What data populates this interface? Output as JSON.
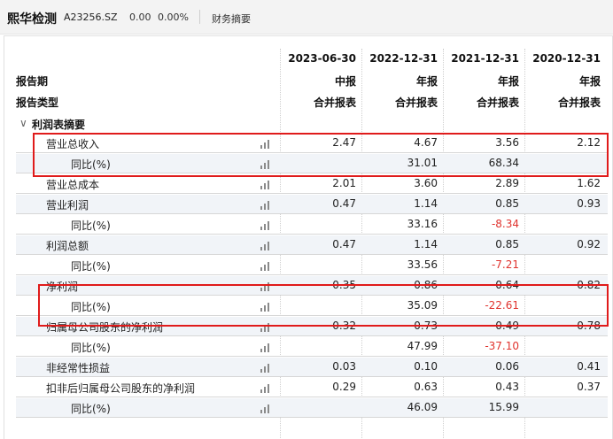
{
  "header": {
    "company": "熙华检测",
    "code": "A23256.SZ",
    "price": "0.00",
    "change_pct": "0.00%",
    "tab": "财务摘要"
  },
  "table": {
    "columns": [
      "2023-06-30",
      "2022-12-31",
      "2021-12-31",
      "2020-12-31"
    ],
    "report_period_label": "报告期",
    "report_type_label": "报告类型",
    "periods": [
      "中报",
      "年报",
      "年报",
      "年报"
    ],
    "report_types": [
      "合并报表",
      "合并报表",
      "合并报表",
      "合并报表"
    ],
    "section_title": "利润表摘要",
    "rows": [
      {
        "label": "营业总收入",
        "values": [
          "2.47",
          "4.67",
          "3.56",
          "2.12"
        ]
      },
      {
        "label": "同比(%)",
        "values": [
          "",
          "31.01",
          "68.34",
          ""
        ]
      },
      {
        "label": "营业总成本",
        "values": [
          "2.01",
          "3.60",
          "2.89",
          "1.62"
        ]
      },
      {
        "label": "营业利润",
        "values": [
          "0.47",
          "1.14",
          "0.85",
          "0.93"
        ]
      },
      {
        "label": "同比(%)",
        "values": [
          "",
          "33.16",
          "-8.34",
          ""
        ]
      },
      {
        "label": "利润总额",
        "values": [
          "0.47",
          "1.14",
          "0.85",
          "0.92"
        ]
      },
      {
        "label": "同比(%)",
        "values": [
          "",
          "33.56",
          "-7.21",
          ""
        ]
      },
      {
        "label": "净利润",
        "values": [
          "0.35",
          "0.86",
          "0.64",
          "0.82"
        ]
      },
      {
        "label": "同比(%)",
        "values": [
          "",
          "35.09",
          "-22.61",
          ""
        ]
      },
      {
        "label": "归属母公司股东的净利润",
        "values": [
          "0.32",
          "0.73",
          "0.49",
          "0.78"
        ]
      },
      {
        "label": "同比(%)",
        "values": [
          "",
          "47.99",
          "-37.10",
          ""
        ]
      },
      {
        "label": "非经常性损益",
        "values": [
          "0.03",
          "0.10",
          "0.06",
          "0.41"
        ]
      },
      {
        "label": "扣非后归属母公司股东的净利润",
        "values": [
          "0.29",
          "0.63",
          "0.43",
          "0.37"
        ]
      },
      {
        "label": "同比(%)",
        "values": [
          "",
          "46.09",
          "15.99",
          ""
        ]
      }
    ]
  },
  "icons": {
    "bar_chart": "bar-chart-icon",
    "collapse": "chevron-down-icon"
  },
  "colors": {
    "negative": "#e0332e",
    "highlight_box": "#e01b1b",
    "row_shade": "#f1f4f8"
  }
}
